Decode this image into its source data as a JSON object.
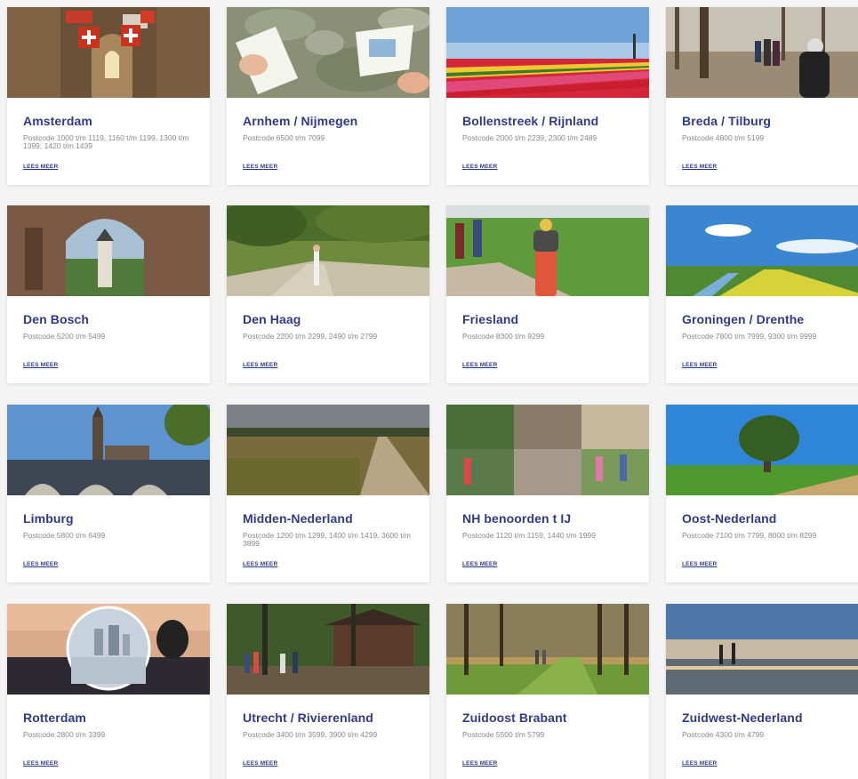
{
  "cards": [
    {
      "title": "Amsterdam",
      "postcode": "Postcode 1000 t/m 1119, 1160 t/m 1199, 1300 t/m 1399, 1420 t/m 1439",
      "more": "LEES MEER"
    },
    {
      "title": "Arnhem / Nijmegen",
      "postcode": "Postcode 6500 t/m 7099",
      "more": "LEES MEER"
    },
    {
      "title": "Bollenstreek / Rijnland",
      "postcode": "Postcode 2000 t/m 2239, 2300 t/m 2489",
      "more": "LEES MEER"
    },
    {
      "title": "Breda / Tilburg",
      "postcode": "Postcode 4800 t/m 5199",
      "more": "LEES MEER"
    },
    {
      "title": "Den Bosch",
      "postcode": "Postcode 5200 t/m 5499",
      "more": "LEES MEER"
    },
    {
      "title": "Den Haag",
      "postcode": "Postcode 2200 t/m 2299, 2490 t/m 2799",
      "more": "LEES MEER"
    },
    {
      "title": "Friesland",
      "postcode": "Postcode 8300 t/m 9299",
      "more": "LEES MEER"
    },
    {
      "title": "Groningen / Drenthe",
      "postcode": "Postcode 7800 t/m 7999, 9300 t/m 9999",
      "more": "LEES MEER"
    },
    {
      "title": "Limburg",
      "postcode": "Postcode 5800 t/m 6499",
      "more": "LEES MEER"
    },
    {
      "title": "Midden-Nederland",
      "postcode": "Postcode 1200 t/m 1299, 1400 t/m 1419, 3600 t/m 3899",
      "more": "LEES MEER"
    },
    {
      "title": "NH benoorden t IJ",
      "postcode": "Postcode 1120 t/m 1159, 1440 t/m 1999",
      "more": "LEES MEER"
    },
    {
      "title": "Oost-Nederland",
      "postcode": "Postcode 7100 t/m 7799, 8000 t/m 8299",
      "more": "LEES MEER"
    },
    {
      "title": "Rotterdam",
      "postcode": "Postcode 2800 t/m 3399",
      "more": "LEES MEER"
    },
    {
      "title": "Utrecht / Rivierenland",
      "postcode": "Postcode 3400 t/m 3599, 3900 t/m 4299",
      "more": "LEES MEER"
    },
    {
      "title": "Zuidoost Brabant",
      "postcode": "Postcode 5500 t/m 5799",
      "more": "LEES MEER"
    },
    {
      "title": "Zuidwest-Nederland",
      "postcode": "Postcode 4300 t/m 4799",
      "more": "LEES MEER"
    }
  ],
  "colors": {
    "title": "#2f3a8c",
    "text": "#888888",
    "card_bg": "#ffffff",
    "page_bg": "#f4f4f4"
  }
}
